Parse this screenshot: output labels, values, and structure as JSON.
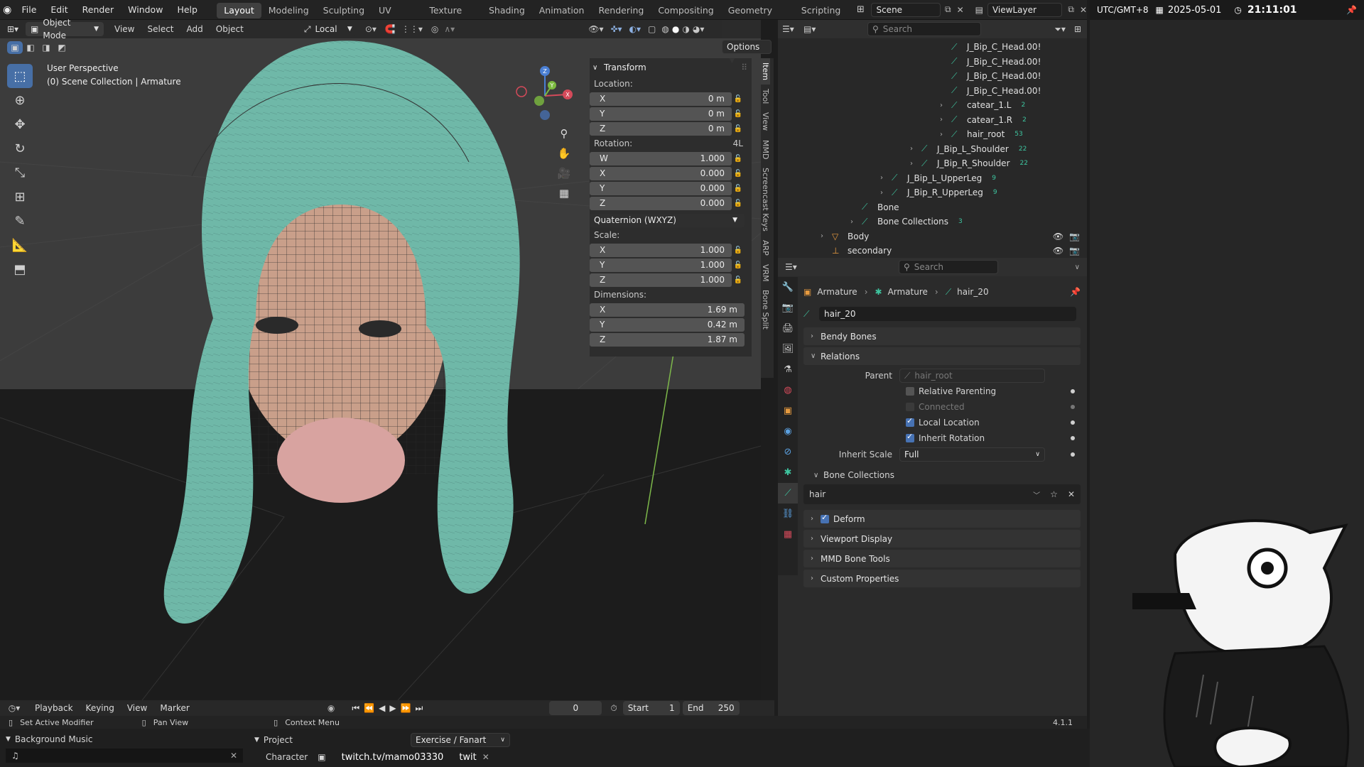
{
  "topbar": {
    "menus": [
      "File",
      "Edit",
      "Render",
      "Window",
      "Help"
    ],
    "workspaces": [
      "Layout",
      "Modeling",
      "Sculpting",
      "UV Editing",
      "Texture Paint",
      "Shading",
      "Animation",
      "Rendering",
      "Compositing",
      "Geometry Nodes",
      "Scripting"
    ],
    "active_workspace": "Layout",
    "scene_label": "Scene",
    "viewlayer_label": "ViewLayer"
  },
  "clock": {
    "timezone": "UTC/GMT+8",
    "date": "2025-05-01",
    "time": "21:11:01"
  },
  "viewport_header": {
    "mode": "Object Mode",
    "menus": [
      "View",
      "Select",
      "Add",
      "Object"
    ],
    "transform_orientation": "Local",
    "options_label": "Options"
  },
  "viewport": {
    "perspective_label": "User Perspective",
    "collection_label": "(0) Scene Collection | Armature",
    "gizmo": {
      "x": "X",
      "y": "Y",
      "z": "Z"
    }
  },
  "npanel": {
    "title": "Transform",
    "location_label": "Location:",
    "location": [
      {
        "axis": "X",
        "value": "0 m"
      },
      {
        "axis": "Y",
        "value": "0 m"
      },
      {
        "axis": "Z",
        "value": "0 m"
      }
    ],
    "rotation_label": "Rotation:",
    "rotation_badge": "4L",
    "rotation": [
      {
        "axis": "W",
        "value": "1.000"
      },
      {
        "axis": "X",
        "value": "0.000"
      },
      {
        "axis": "Y",
        "value": "0.000"
      },
      {
        "axis": "Z",
        "value": "0.000"
      }
    ],
    "rotation_mode": "Quaternion (WXYZ)",
    "scale_label": "Scale:",
    "scale": [
      {
        "axis": "X",
        "value": "1.000"
      },
      {
        "axis": "Y",
        "value": "1.000"
      },
      {
        "axis": "Z",
        "value": "1.000"
      }
    ],
    "dimensions_label": "Dimensions:",
    "dimensions": [
      {
        "axis": "X",
        "value": "1.69 m"
      },
      {
        "axis": "Y",
        "value": "0.42 m"
      },
      {
        "axis": "Z",
        "value": "1.87 m"
      }
    ]
  },
  "sidetabs": [
    "Item",
    "Tool",
    "View",
    "MMD",
    "Screencast Keys",
    "ARP",
    "VRM",
    "Bone Split"
  ],
  "outliner": {
    "search_placeholder": "Search",
    "rows": [
      {
        "label": "J_Bip_C_Head.00!",
        "indent": 4,
        "expander": false,
        "badge": ""
      },
      {
        "label": "J_Bip_C_Head.00!",
        "indent": 4,
        "expander": false,
        "badge": ""
      },
      {
        "label": "J_Bip_C_Head.00!",
        "indent": 4,
        "expander": false,
        "badge": ""
      },
      {
        "label": "J_Bip_C_Head.00!",
        "indent": 4,
        "expander": false,
        "badge": ""
      },
      {
        "label": "catear_1.L",
        "indent": 4,
        "expander": true,
        "badge": "2"
      },
      {
        "label": "catear_1.R",
        "indent": 4,
        "expander": true,
        "badge": "2"
      },
      {
        "label": "hair_root",
        "indent": 4,
        "expander": true,
        "badge": "53"
      },
      {
        "label": "J_Bip_L_Shoulder",
        "indent": 3,
        "expander": true,
        "badge": "22"
      },
      {
        "label": "J_Bip_R_Shoulder",
        "indent": 3,
        "expander": true,
        "badge": "22"
      },
      {
        "label": "J_Bip_L_UpperLeg",
        "indent": 2,
        "expander": true,
        "badge": "9"
      },
      {
        "label": "J_Bip_R_UpperLeg",
        "indent": 2,
        "expander": true,
        "badge": "9"
      },
      {
        "label": "Bone",
        "indent": 1,
        "expander": false,
        "badge": ""
      },
      {
        "label": "Bone Collections",
        "indent": 1,
        "expander": true,
        "badge": "3"
      },
      {
        "label": "Body",
        "indent": 0,
        "expander": true,
        "badge": ""
      },
      {
        "label": "secondary",
        "indent": 0,
        "expander": false,
        "badge": ""
      }
    ]
  },
  "props": {
    "search_placeholder": "Search",
    "breadcrumb": [
      "Armature",
      "Armature",
      "hair_20"
    ],
    "bone_name": "hair_20",
    "bendy_bones": "Bendy Bones",
    "relations": "Relations",
    "parent_label": "Parent",
    "parent_value": "hair_root",
    "relative_parenting": "Relative Parenting",
    "connected": "Connected",
    "local_location": "Local Location",
    "inherit_rotation": "Inherit Rotation",
    "inherit_scale_label": "Inherit Scale",
    "inherit_scale_value": "Full",
    "bone_collections": "Bone Collections",
    "collection_value": "hair",
    "deform": "Deform",
    "viewport_display": "Viewport Display",
    "mmd_bone_tools": "MMD Bone Tools",
    "custom_properties": "Custom Properties"
  },
  "timeline": {
    "menus": [
      "Playback",
      "Keying",
      "View",
      "Marker"
    ],
    "current_frame": "0",
    "start_label": "Start",
    "start_value": "1",
    "end_label": "End",
    "end_value": "250"
  },
  "statusbar": {
    "items": [
      "Set Active Modifier",
      "Pan View",
      "Context Menu"
    ],
    "version": "4.1.1"
  },
  "bottom": {
    "music_title": "Background Music",
    "project_title": "Project",
    "project_value": "Exercise / Fanart",
    "character_label": "Character",
    "character_value": "twitch.tv/mamo03330",
    "character_extra": "twit"
  },
  "colors": {
    "accent": "#4772b3",
    "bone_green": "#3ec6a0",
    "hair": "#7fc4b4",
    "header": "#232323"
  }
}
